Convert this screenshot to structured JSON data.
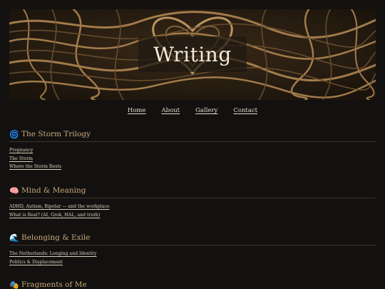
{
  "hero": {
    "title": "Writing",
    "colors": {
      "dark": "#221a10",
      "light": "#c79d63",
      "mid": "#7a5d36"
    }
  },
  "nav": [
    {
      "label": "Home"
    },
    {
      "label": "About"
    },
    {
      "label": "Gallery"
    },
    {
      "label": "Contact"
    }
  ],
  "sections": [
    {
      "emoji": "🌀",
      "title": "The Storm Trilogy",
      "links": [
        "Pregnancy",
        "The Storm",
        "Where the Storm Rests"
      ]
    },
    {
      "emoji": "🧠",
      "title": "Mind & Meaning",
      "links": [
        "ADHD, Autism, Bipolar — and the workplace",
        "What is Real? (AI, Grok, HAL, and truth)"
      ]
    },
    {
      "emoji": "🌊",
      "title": "Belonging & Exile",
      "links": [
        "The Netherlands: Longing and Identity",
        "Politics & Displacement"
      ]
    },
    {
      "emoji": "🎭",
      "title": "Fragments of Me",
      "links": []
    }
  ],
  "theme": {
    "background": "#121110",
    "accent": "#c9a877",
    "text": "#d9cfbd"
  }
}
